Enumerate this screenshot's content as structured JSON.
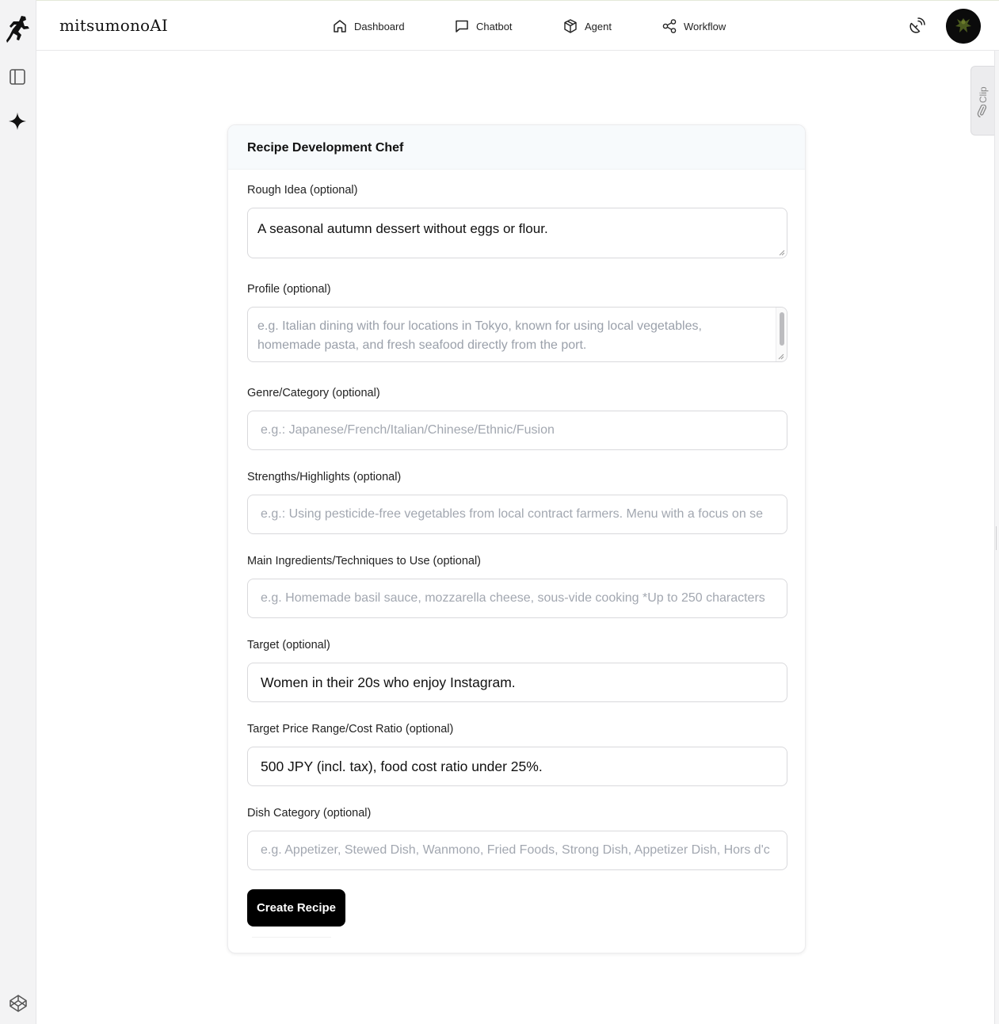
{
  "app": {
    "brand": "mitsumonoAI"
  },
  "nav": [
    {
      "label": "Dashboard",
      "icon": "home-icon"
    },
    {
      "label": "Chatbot",
      "icon": "chat-bubble-icon"
    },
    {
      "label": "Agent",
      "icon": "cube-icon"
    },
    {
      "label": "Workflow",
      "icon": "share-nodes-icon"
    }
  ],
  "rail": {
    "icons": [
      "runner-logo-icon",
      "sidebar-panel-icon",
      "sparkle-icon",
      "codepen-icon"
    ]
  },
  "header_actions": {
    "icons": [
      "satellite-dish-icon",
      "avatar"
    ]
  },
  "clip_tab": {
    "label": "Clip",
    "icon": "paperclip-icon"
  },
  "form": {
    "title": "Recipe Development Chef",
    "fields": {
      "rough_idea": {
        "label": "Rough Idea (optional)",
        "value": "A seasonal autumn dessert without eggs or flour."
      },
      "profile": {
        "label": "Profile (optional)",
        "placeholder": "e.g. Italian dining with four locations in Tokyo, known for using local vegetables, homemade pasta, and fresh seafood directly from the port."
      },
      "genre": {
        "label": "Genre/Category (optional)",
        "placeholder": "e.g.: Japanese/French/Italian/Chinese/Ethnic/Fusion"
      },
      "strengths": {
        "label": "Strengths/Highlights (optional)",
        "placeholder": "e.g.: Using pesticide-free vegetables from local contract farmers. Menu with a focus on se"
      },
      "ingredients": {
        "label": "Main Ingredients/Techniques to Use (optional)",
        "placeholder": "e.g. Homemade basil sauce, mozzarella cheese, sous-vide cooking *Up to 250 characters"
      },
      "target": {
        "label": "Target (optional)",
        "value": "Women in their 20s who enjoy Instagram."
      },
      "price": {
        "label": "Target Price Range/Cost Ratio (optional)",
        "value": "500 JPY (incl. tax), food cost ratio under 25%."
      },
      "dish_category": {
        "label": "Dish Category (optional)",
        "placeholder": "e.g. Appetizer, Stewed Dish, Wanmono, Fried Foods, Strong Dish, Appetizer Dish, Hors d'c"
      }
    },
    "submit_label": "Create Recipe"
  }
}
